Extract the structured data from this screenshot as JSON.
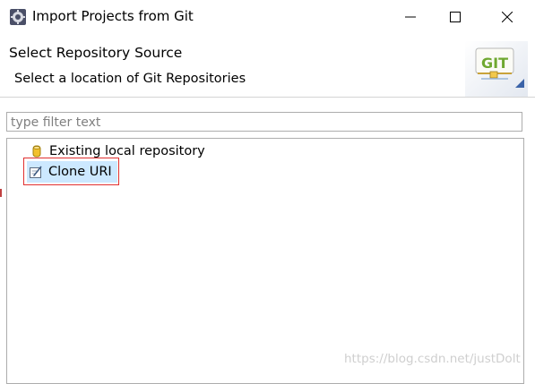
{
  "window": {
    "title": "Import Projects from Git",
    "icon": "eclipse-gear-icon"
  },
  "header": {
    "title": "Select Repository Source",
    "description": "Select a location of Git Repositories",
    "banner_text": "GIT",
    "banner_icon": "git-banner-icon"
  },
  "filter": {
    "placeholder": "type filter text",
    "value": ""
  },
  "tree": {
    "items": [
      {
        "label": "Existing local repository",
        "icon": "repository-cylinder-icon",
        "selected": false
      },
      {
        "label": "Clone URI",
        "icon": "clone-uri-icon",
        "selected": true
      }
    ]
  },
  "watermark": "https://blog.csdn.net/justDolt",
  "colors": {
    "selection": "#cce8ff",
    "highlight_border": "#e03030",
    "banner_text": "#6fa830"
  }
}
